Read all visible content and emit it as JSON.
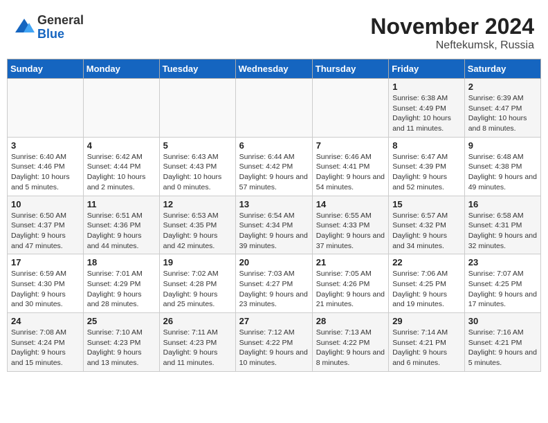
{
  "logo": {
    "general": "General",
    "blue": "Blue"
  },
  "header": {
    "month_year": "November 2024",
    "location": "Neftekumsk, Russia"
  },
  "weekdays": [
    "Sunday",
    "Monday",
    "Tuesday",
    "Wednesday",
    "Thursday",
    "Friday",
    "Saturday"
  ],
  "weeks": [
    [
      {
        "day": "",
        "info": ""
      },
      {
        "day": "",
        "info": ""
      },
      {
        "day": "",
        "info": ""
      },
      {
        "day": "",
        "info": ""
      },
      {
        "day": "",
        "info": ""
      },
      {
        "day": "1",
        "info": "Sunrise: 6:38 AM\nSunset: 4:49 PM\nDaylight: 10 hours and 11 minutes."
      },
      {
        "day": "2",
        "info": "Sunrise: 6:39 AM\nSunset: 4:47 PM\nDaylight: 10 hours and 8 minutes."
      }
    ],
    [
      {
        "day": "3",
        "info": "Sunrise: 6:40 AM\nSunset: 4:46 PM\nDaylight: 10 hours and 5 minutes."
      },
      {
        "day": "4",
        "info": "Sunrise: 6:42 AM\nSunset: 4:44 PM\nDaylight: 10 hours and 2 minutes."
      },
      {
        "day": "5",
        "info": "Sunrise: 6:43 AM\nSunset: 4:43 PM\nDaylight: 10 hours and 0 minutes."
      },
      {
        "day": "6",
        "info": "Sunrise: 6:44 AM\nSunset: 4:42 PM\nDaylight: 9 hours and 57 minutes."
      },
      {
        "day": "7",
        "info": "Sunrise: 6:46 AM\nSunset: 4:41 PM\nDaylight: 9 hours and 54 minutes."
      },
      {
        "day": "8",
        "info": "Sunrise: 6:47 AM\nSunset: 4:39 PM\nDaylight: 9 hours and 52 minutes."
      },
      {
        "day": "9",
        "info": "Sunrise: 6:48 AM\nSunset: 4:38 PM\nDaylight: 9 hours and 49 minutes."
      }
    ],
    [
      {
        "day": "10",
        "info": "Sunrise: 6:50 AM\nSunset: 4:37 PM\nDaylight: 9 hours and 47 minutes."
      },
      {
        "day": "11",
        "info": "Sunrise: 6:51 AM\nSunset: 4:36 PM\nDaylight: 9 hours and 44 minutes."
      },
      {
        "day": "12",
        "info": "Sunrise: 6:53 AM\nSunset: 4:35 PM\nDaylight: 9 hours and 42 minutes."
      },
      {
        "day": "13",
        "info": "Sunrise: 6:54 AM\nSunset: 4:34 PM\nDaylight: 9 hours and 39 minutes."
      },
      {
        "day": "14",
        "info": "Sunrise: 6:55 AM\nSunset: 4:33 PM\nDaylight: 9 hours and 37 minutes."
      },
      {
        "day": "15",
        "info": "Sunrise: 6:57 AM\nSunset: 4:32 PM\nDaylight: 9 hours and 34 minutes."
      },
      {
        "day": "16",
        "info": "Sunrise: 6:58 AM\nSunset: 4:31 PM\nDaylight: 9 hours and 32 minutes."
      }
    ],
    [
      {
        "day": "17",
        "info": "Sunrise: 6:59 AM\nSunset: 4:30 PM\nDaylight: 9 hours and 30 minutes."
      },
      {
        "day": "18",
        "info": "Sunrise: 7:01 AM\nSunset: 4:29 PM\nDaylight: 9 hours and 28 minutes."
      },
      {
        "day": "19",
        "info": "Sunrise: 7:02 AM\nSunset: 4:28 PM\nDaylight: 9 hours and 25 minutes."
      },
      {
        "day": "20",
        "info": "Sunrise: 7:03 AM\nSunset: 4:27 PM\nDaylight: 9 hours and 23 minutes."
      },
      {
        "day": "21",
        "info": "Sunrise: 7:05 AM\nSunset: 4:26 PM\nDaylight: 9 hours and 21 minutes."
      },
      {
        "day": "22",
        "info": "Sunrise: 7:06 AM\nSunset: 4:25 PM\nDaylight: 9 hours and 19 minutes."
      },
      {
        "day": "23",
        "info": "Sunrise: 7:07 AM\nSunset: 4:25 PM\nDaylight: 9 hours and 17 minutes."
      }
    ],
    [
      {
        "day": "24",
        "info": "Sunrise: 7:08 AM\nSunset: 4:24 PM\nDaylight: 9 hours and 15 minutes."
      },
      {
        "day": "25",
        "info": "Sunrise: 7:10 AM\nSunset: 4:23 PM\nDaylight: 9 hours and 13 minutes."
      },
      {
        "day": "26",
        "info": "Sunrise: 7:11 AM\nSunset: 4:23 PM\nDaylight: 9 hours and 11 minutes."
      },
      {
        "day": "27",
        "info": "Sunrise: 7:12 AM\nSunset: 4:22 PM\nDaylight: 9 hours and 10 minutes."
      },
      {
        "day": "28",
        "info": "Sunrise: 7:13 AM\nSunset: 4:22 PM\nDaylight: 9 hours and 8 minutes."
      },
      {
        "day": "29",
        "info": "Sunrise: 7:14 AM\nSunset: 4:21 PM\nDaylight: 9 hours and 6 minutes."
      },
      {
        "day": "30",
        "info": "Sunrise: 7:16 AM\nSunset: 4:21 PM\nDaylight: 9 hours and 5 minutes."
      }
    ]
  ]
}
